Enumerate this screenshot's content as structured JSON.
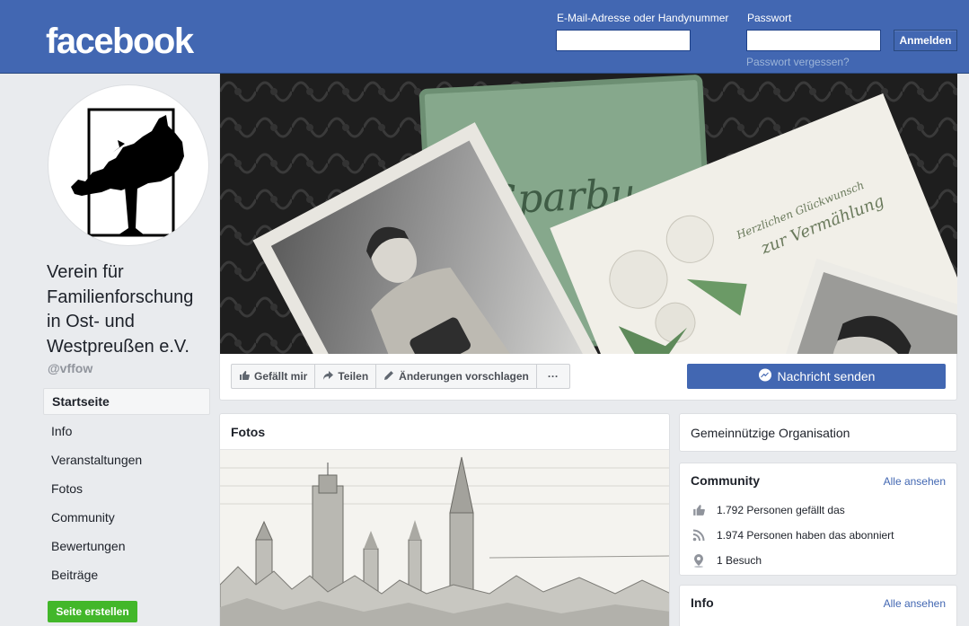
{
  "header": {
    "logo": "facebook",
    "email_label": "E-Mail-Adresse oder Handynummer",
    "email_value": "",
    "password_label": "Passwort",
    "password_value": "",
    "login_button": "Anmelden",
    "forgot_link": "Passwort vergessen?"
  },
  "profile": {
    "name": "Verein für Familienforschung in Ost- und Westpreußen e.V.",
    "handle": "@vffow"
  },
  "nav": {
    "items": [
      {
        "label": "Startseite"
      },
      {
        "label": "Info"
      },
      {
        "label": "Veranstaltungen"
      },
      {
        "label": "Fotos"
      },
      {
        "label": "Community"
      },
      {
        "label": "Bewertungen"
      },
      {
        "label": "Beiträge"
      }
    ],
    "create_page": "Seite erstellen"
  },
  "actions": {
    "like": "Gefällt mir",
    "share": "Teilen",
    "suggest": "Änderungen vorschlagen",
    "more": "···",
    "message": "Nachricht senden"
  },
  "cover_texts": {
    "card_line1": "Herzlichen Glückwunsch",
    "card_line2": "zur Vermählung",
    "book_text": "Sparbu"
  },
  "fotos": {
    "title": "Fotos"
  },
  "category": {
    "label": "Gemeinnützige Organisation"
  },
  "community": {
    "title": "Community",
    "see_all": "Alle ansehen",
    "likes": "1.792 Personen gefällt das",
    "followers": "1.974 Personen haben das abonniert",
    "visits": "1 Besuch"
  },
  "info": {
    "title": "Info",
    "see_all": "Alle ansehen"
  },
  "colors": {
    "brand": "#4267b2",
    "green": "#42b72a"
  },
  "icons": {
    "like": "thumbs-up-icon",
    "share": "share-arrow-icon",
    "edit": "pencil-icon",
    "messenger": "messenger-icon",
    "followers": "rss-icon",
    "visits": "location-pin-icon"
  }
}
